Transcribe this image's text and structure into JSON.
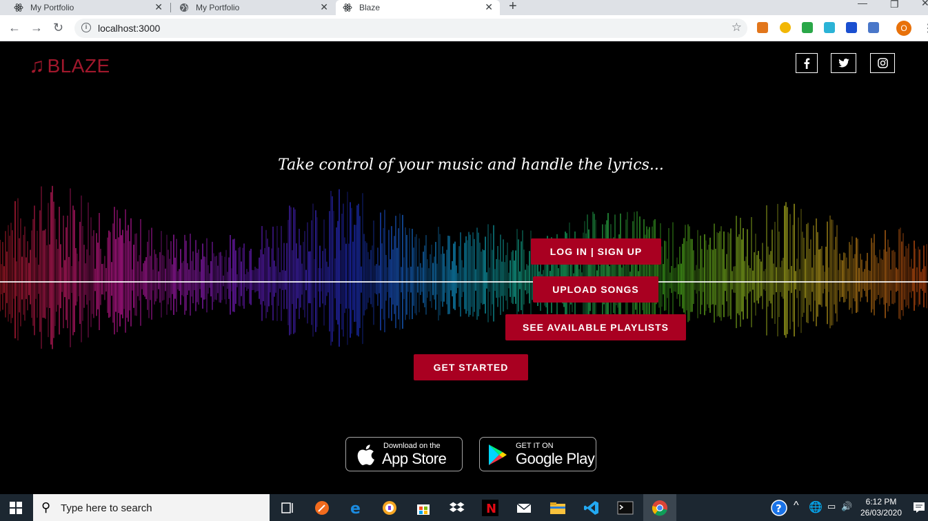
{
  "browser": {
    "tabs": [
      {
        "title": "My Portfolio"
      },
      {
        "title": "My Portfolio"
      },
      {
        "title": "Blaze"
      }
    ],
    "url": "localhost:3000",
    "profile_initial": "O"
  },
  "page": {
    "brand": "BLAZE",
    "tagline": "Take control of your music and handle the lyrics...",
    "buttons": {
      "login": "LOG IN | SIGN UP",
      "upload": "UPLOAD SONGS",
      "playlists": "SEE AVAILABLE PLAYLISTS",
      "get_started": "GET STARTED"
    },
    "app_store": {
      "small": "Download on the",
      "big": "App Store"
    },
    "google_play": {
      "small": "GET IT ON",
      "big": "Google Play"
    },
    "colors": {
      "accent": "#a90021",
      "logo": "#a1182c"
    }
  },
  "taskbar": {
    "search_placeholder": "Type here to search",
    "time": "6:12 PM",
    "date": "26/03/2020"
  }
}
